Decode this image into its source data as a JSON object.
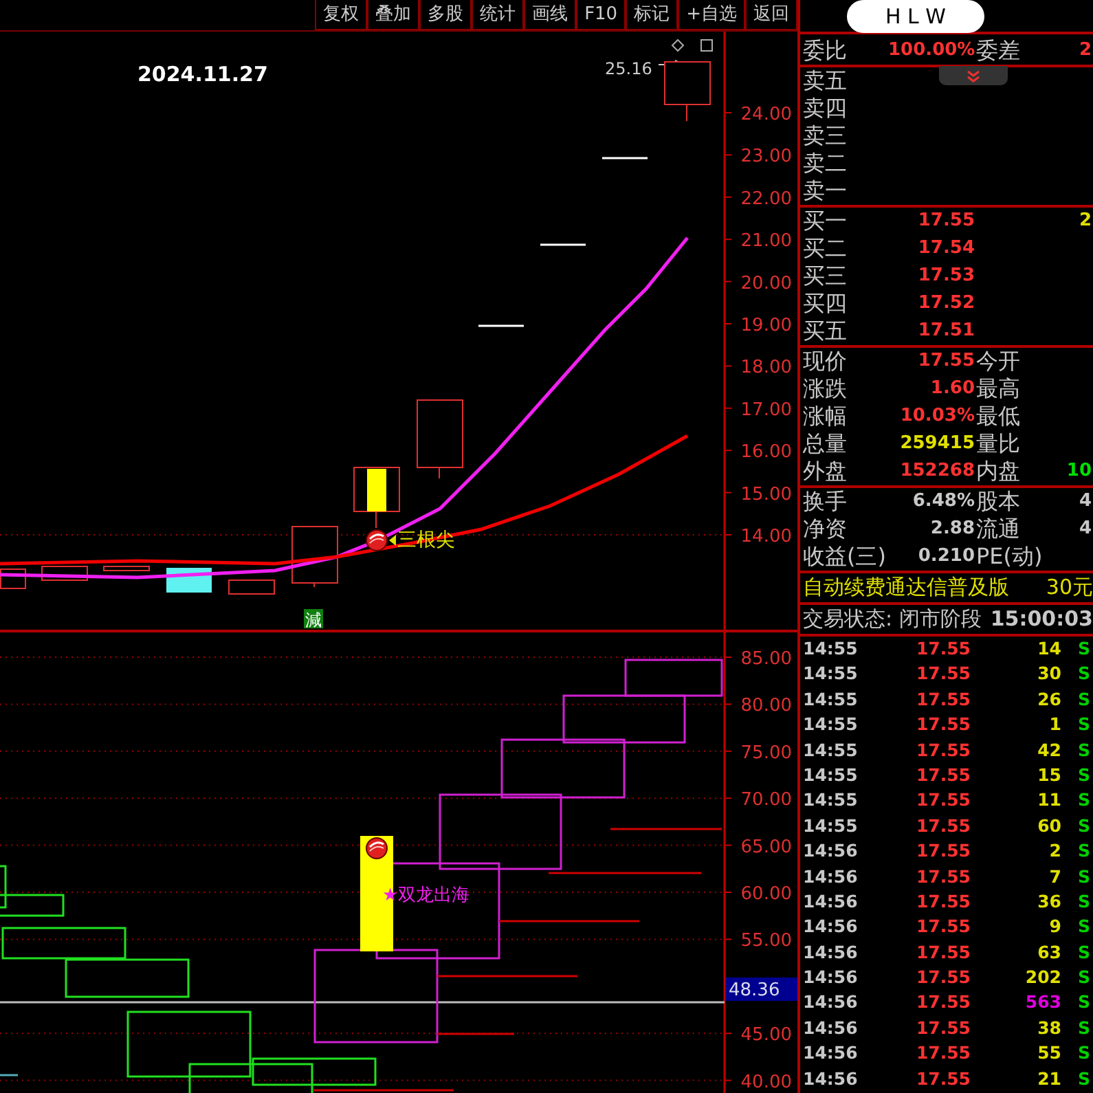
{
  "toolbar": {
    "buttons": [
      "复权",
      "叠加",
      "多股",
      "统计",
      "画线",
      "F10",
      "标记",
      "+自选",
      "返回"
    ]
  },
  "header": {
    "title": "H L W"
  },
  "upper_chart": {
    "date": "2024.11.27",
    "high_marker": "25.16",
    "price_ticks": [
      "24.00",
      "23.00",
      "22.00",
      "21.00",
      "20.00",
      "19.00",
      "18.00",
      "17.00",
      "16.00",
      "15.00",
      "14.00"
    ],
    "signal_label": "三根尖",
    "badge": "減"
  },
  "lower_chart": {
    "price_ticks": [
      "85.00",
      "80.00",
      "75.00",
      "70.00",
      "65.00",
      "60.00",
      "55.00",
      "45.00",
      "40.00"
    ],
    "current_value": "48.36",
    "signal_label": "★双龙出海"
  },
  "quote_panel": {
    "sections": [
      {
        "rows": [
          {
            "label": "委比",
            "value": {
              "text": "100.00%",
              "color": "#ff3232"
            },
            "label_2": "委差",
            "value_2": {
              "text": "2",
              "color": "#ff3232"
            }
          }
        ]
      },
      {
        "rows": [
          {
            "label": "卖五"
          },
          {
            "label": "卖四"
          },
          {
            "label": "卖三"
          },
          {
            "label": "卖二"
          },
          {
            "label": "卖一"
          }
        ]
      },
      {
        "rows": [
          {
            "label": "买一",
            "value": {
              "text": "17.55",
              "color": "#ff3232"
            },
            "value_2": {
              "text": "2",
              "color": "#e0e000"
            }
          },
          {
            "label": "买二",
            "value": {
              "text": "17.54",
              "color": "#ff3232"
            }
          },
          {
            "label": "买三",
            "value": {
              "text": "17.53",
              "color": "#ff3232"
            }
          },
          {
            "label": "买四",
            "value": {
              "text": "17.52",
              "color": "#ff3232"
            }
          },
          {
            "label": "买五",
            "value": {
              "text": "17.51",
              "color": "#ff3232"
            }
          }
        ]
      },
      {
        "rows": [
          {
            "label": "现价",
            "value": {
              "text": "17.55",
              "color": "#ff3232"
            },
            "label_2": "今开"
          },
          {
            "label": "涨跌",
            "value": {
              "text": "1.60",
              "color": "#ff3232"
            },
            "label_2": "最高"
          },
          {
            "label": "涨幅",
            "value": {
              "text": "10.03%",
              "color": "#ff3232"
            },
            "label_2": "最低"
          },
          {
            "label": "总量",
            "value": {
              "text": "259415",
              "color": "#e0e000"
            },
            "label_2": "量比"
          },
          {
            "label": "外盘",
            "value": {
              "text": "152268",
              "color": "#ff3232"
            },
            "label_2": "内盘",
            "value_2": {
              "text": "10",
              "color": "#00e000"
            }
          }
        ]
      },
      {
        "rows": [
          {
            "label": "换手",
            "value": {
              "text": "6.48%",
              "color": "#c8c8c8"
            },
            "label_2": "股本",
            "value_2": {
              "text": "4",
              "color": "#c8c8c8"
            }
          },
          {
            "label": "净资",
            "value": {
              "text": "2.88",
              "color": "#c8c8c8"
            },
            "label_2": "流通",
            "value_2": {
              "text": "4",
              "color": "#c8c8c8"
            }
          },
          {
            "label": "收益(三)",
            "value": {
              "text": "0.210",
              "color": "#c8c8c8"
            },
            "label_2": "PE(动)"
          }
        ]
      }
    ],
    "promo": {
      "text": "自动续费通达信普及版",
      "price": "30元"
    },
    "status": {
      "text": "交易状态: 闭市阶段",
      "time": "15:00:03"
    },
    "collapse_expanded": false
  },
  "ticks": [
    {
      "time": "14:55",
      "price": "17.55",
      "volume": "14",
      "color": "#e0e000",
      "flag": "S"
    },
    {
      "time": "14:55",
      "price": "17.55",
      "volume": "30",
      "color": "#e0e000",
      "flag": "S"
    },
    {
      "time": "14:55",
      "price": "17.55",
      "volume": "26",
      "color": "#e0e000",
      "flag": "S"
    },
    {
      "time": "14:55",
      "price": "17.55",
      "volume": "1",
      "color": "#e0e000",
      "flag": "S"
    },
    {
      "time": "14:55",
      "price": "17.55",
      "volume": "42",
      "color": "#e0e000",
      "flag": "S"
    },
    {
      "time": "14:55",
      "price": "17.55",
      "volume": "15",
      "color": "#e0e000",
      "flag": "S"
    },
    {
      "time": "14:55",
      "price": "17.55",
      "volume": "11",
      "color": "#e0e000",
      "flag": "S"
    },
    {
      "time": "14:55",
      "price": "17.55",
      "volume": "60",
      "color": "#e0e000",
      "flag": "S"
    },
    {
      "time": "14:56",
      "price": "17.55",
      "volume": "2",
      "color": "#e0e000",
      "flag": "S"
    },
    {
      "time": "14:56",
      "price": "17.55",
      "volume": "7",
      "color": "#e0e000",
      "flag": "S"
    },
    {
      "time": "14:56",
      "price": "17.55",
      "volume": "36",
      "color": "#e0e000",
      "flag": "S"
    },
    {
      "time": "14:56",
      "price": "17.55",
      "volume": "9",
      "color": "#e0e000",
      "flag": "S"
    },
    {
      "time": "14:56",
      "price": "17.55",
      "volume": "63",
      "color": "#e0e000",
      "flag": "S"
    },
    {
      "time": "14:56",
      "price": "17.55",
      "volume": "202",
      "color": "#e0e000",
      "flag": "S"
    },
    {
      "time": "14:56",
      "price": "17.55",
      "volume": "563",
      "color": "#e000e0",
      "flag": "S"
    },
    {
      "time": "14:56",
      "price": "17.55",
      "volume": "38",
      "color": "#e0e000",
      "flag": "S"
    },
    {
      "time": "14:56",
      "price": "17.55",
      "volume": "55",
      "color": "#e0e000",
      "flag": "S"
    },
    {
      "time": "14:56",
      "price": "17.55",
      "volume": "21",
      "color": "#e0e000",
      "flag": "S"
    }
  ]
}
